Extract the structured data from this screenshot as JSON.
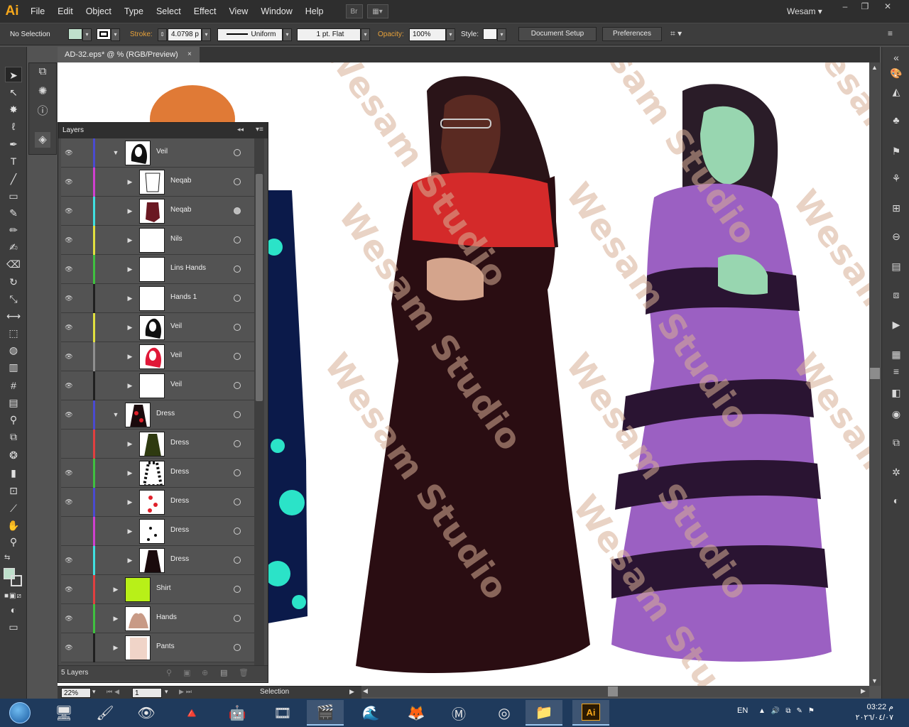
{
  "app": {
    "logo": "Ai",
    "menus": [
      "File",
      "Edit",
      "Object",
      "Type",
      "Select",
      "Effect",
      "View",
      "Window",
      "Help"
    ],
    "bridge_button": "Br",
    "workspace": "Wesam",
    "window_controls": [
      "–",
      "❐",
      "✕"
    ]
  },
  "control_bar": {
    "selection_label": "No Selection",
    "fill_color": "#bfe0cc",
    "stroke_label": "Stroke:",
    "stroke_value": "4.0798 p",
    "stroke_profile": "Uniform",
    "brush": "1 pt. Flat",
    "opacity_label": "Opacity:",
    "opacity_value": "100%",
    "style_label": "Style:",
    "document_setup": "Document Setup",
    "preferences": "Preferences"
  },
  "document": {
    "tab_title": "AD-32.eps* @ % (RGB/Preview)",
    "tab_close": "×",
    "watermark": "Wesam Studio"
  },
  "layers_panel": {
    "title": "Layers",
    "layers_count": "5 Layers",
    "rows": [
      {
        "name": "Veil",
        "color": "#4a4ad0",
        "expanded": true,
        "indent": 0,
        "eye": true,
        "thumb": "veil-black"
      },
      {
        "name": "Neqab",
        "color": "#d040d0",
        "expanded": false,
        "indent": 1,
        "eye": true,
        "thumb": "outline"
      },
      {
        "name": "Neqab",
        "color": "#40e0e0",
        "expanded": false,
        "indent": 1,
        "eye": true,
        "thumb": "maroon",
        "selected_target": true
      },
      {
        "name": "Nils",
        "color": "#e0e040",
        "expanded": false,
        "indent": 1,
        "eye": true,
        "thumb": "blank"
      },
      {
        "name": "Lins Hands",
        "color": "#40c040",
        "expanded": false,
        "indent": 1,
        "eye": true,
        "thumb": "blank"
      },
      {
        "name": "Hands 1",
        "color": "#202020",
        "expanded": false,
        "indent": 1,
        "eye": true,
        "thumb": "blank"
      },
      {
        "name": "Veil",
        "color": "#e0e040",
        "expanded": false,
        "indent": 1,
        "eye": true,
        "thumb": "veil-black"
      },
      {
        "name": "Veil",
        "color": "#909090",
        "expanded": false,
        "indent": 1,
        "eye": true,
        "thumb": "veil-red"
      },
      {
        "name": "Veil",
        "color": "#202020",
        "expanded": false,
        "indent": 1,
        "eye": true,
        "thumb": "blank"
      },
      {
        "name": "Dress",
        "color": "#4a4ad0",
        "expanded": true,
        "indent": 0,
        "eye": true,
        "thumb": "dress-red"
      },
      {
        "name": "Dress",
        "color": "#e04040",
        "expanded": false,
        "indent": 1,
        "eye": false,
        "thumb": "dress-green"
      },
      {
        "name": "Dress",
        "color": "#40c040",
        "expanded": false,
        "indent": 1,
        "eye": true,
        "thumb": "dress-stripe"
      },
      {
        "name": "Dress",
        "color": "#4a4ad0",
        "expanded": false,
        "indent": 1,
        "eye": true,
        "thumb": "dress-hearts"
      },
      {
        "name": "Dress",
        "color": "#d040d0",
        "expanded": false,
        "indent": 1,
        "eye": false,
        "thumb": "dress-dots"
      },
      {
        "name": "Dress",
        "color": "#40e0e0",
        "expanded": false,
        "indent": 1,
        "eye": true,
        "thumb": "dress-black"
      },
      {
        "name": "Shirt",
        "color": "#e04040",
        "expanded": false,
        "indent": 0,
        "eye": true,
        "thumb": "shirt"
      },
      {
        "name": "Hands",
        "color": "#40c040",
        "expanded": false,
        "indent": 0,
        "eye": true,
        "thumb": "hands"
      },
      {
        "name": "Pants",
        "color": "#202020",
        "expanded": false,
        "indent": 0,
        "eye": true,
        "thumb": "pants"
      }
    ]
  },
  "status_bar": {
    "zoom": "22%",
    "artboard": "1",
    "tool": "Selection"
  },
  "taskbar": {
    "language": "EN",
    "time": "03:22 م",
    "date": "٢٠٢٦/٠٤/٠٧"
  }
}
